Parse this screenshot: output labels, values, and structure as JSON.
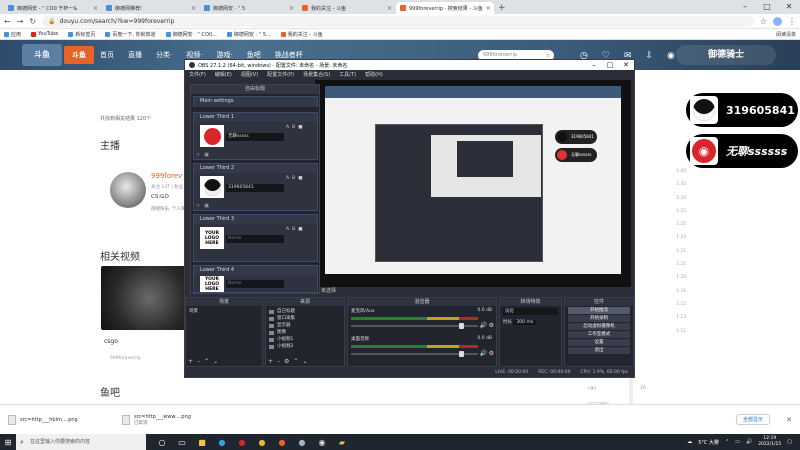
{
  "browser": {
    "tabs": [
      {
        "title": "御德网安 - “ CO0 干杯一&"
      },
      {
        "title": "御德网推荐!"
      },
      {
        "title": "御德网安 · “ 5"
      },
      {
        "title": "我的关注 - 斗鱼"
      },
      {
        "title": "999foreverrip · 搜索结果 - 斗鱼"
      }
    ],
    "new_tab": "+",
    "url": "douyu.com/search/?kw=999foreverrip",
    "bookmarks": [
      "应用",
      "YouTube",
      "新标签页",
      "百度一下, 你就知道",
      "御德网安 · “ CO0...",
      "御德网安 · “ 5...",
      "我的关注 - 斗鱼"
    ],
    "bookmarks_right": "阅读清单"
  },
  "douyu": {
    "nav": [
      "首页",
      "直播",
      "分类·",
      "视频·",
      "游戏·",
      "鱼吧",
      "挑战者杯"
    ],
    "search_placeholder": "999foreverrip",
    "brand": "御德骑士",
    "related_label": "共找到相关结果 120个",
    "zhubo": "主播",
    "anchor_name": "999forev",
    "anchor_sub": "关注 14T | 粉丝 1111",
    "anchor_game": "CS:GO",
    "anchor_desc": "御德快乐, 个人简介",
    "related_videos": "相关视频",
    "video_label": "csgo",
    "video_author": "999foreverrip",
    "yuba": "鱼吧",
    "right_col": [
      "1:40",
      "1:35",
      "1:20",
      "1:25",
      "1:25",
      "1:24",
      "1:21",
      "1:21",
      "1:20",
      "1:16",
      "1:15",
      "1:13",
      "1:12"
    ],
    "right_bottom": [
      "cgo",
      "10",
      "CSGO锁头"
    ]
  },
  "obs": {
    "title": "OBS 27.1.2 (64-bit, windows) - 配置文件: 未命名 - 场景: 未命名",
    "menu": [
      "文件(F)",
      "编辑(E)",
      "视图(V)",
      "配置文件(P)",
      "场景集合(S)",
      "工具(T)",
      "帮助(H)"
    ],
    "dock_title": "自由标题",
    "main_settings": "Main settings",
    "lower_thirds": [
      {
        "name": "Lower Third 1",
        "text": "无聊sssss"
      },
      {
        "name": "Lower Third 2",
        "text": "319605841"
      },
      {
        "name": "Lower Third 3",
        "text": "Name"
      },
      {
        "name": "Lower Third 4",
        "text": "Name"
      }
    ],
    "your_logo": "YOUR LOGO HERE",
    "scene_bar": "未选择",
    "panels": {
      "scenes": {
        "title": "场景",
        "items": [
          "场景"
        ]
      },
      "sources": {
        "title": "来源",
        "items": [
          "自己标题",
          "窗口采集",
          "显示器",
          "图像",
          "小视频1",
          "小视频2"
        ]
      },
      "mixer": {
        "title": "混音器",
        "channels": [
          {
            "name": "麦克风/Aux",
            "db": "0.0 dB"
          },
          {
            "name": "桌面音频",
            "db": "0.0 dB"
          }
        ]
      },
      "transitions": {
        "title": "转场特效",
        "type": "淡化",
        "duration_label": "时长",
        "duration": "300 ms"
      },
      "controls": {
        "title": "控件",
        "buttons": [
          "开始推流",
          "开始录制",
          "启动虚拟摄像机",
          "工作室模式",
          "设置",
          "退出"
        ]
      }
    },
    "status": [
      "LIVE: 00:00:00",
      "REC: 00:00:00",
      "CPU: 1.9%, 60.00 fps"
    ]
  },
  "overlays": {
    "qq_text": "319605841",
    "ne_text": "无聊ssssss"
  },
  "downloads": {
    "items": [
      {
        "name": "src=http___hbim....png",
        "sub": ""
      },
      {
        "name": "src=http___www....png",
        "sub": "已取消"
      }
    ],
    "show_all": "全部显示",
    "close": "✕"
  },
  "taskbar": {
    "search": "在这里输入你要搜索的内容",
    "weather": "5°C 大雾",
    "time": "12:19",
    "date": "2022/1/15"
  }
}
